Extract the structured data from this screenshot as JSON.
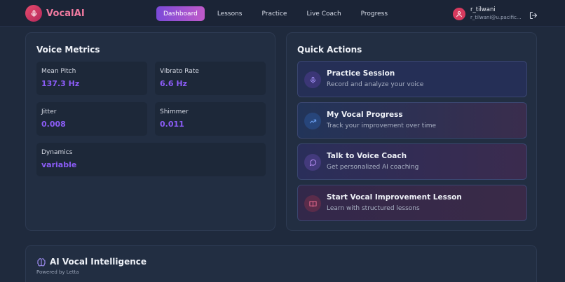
{
  "brand": {
    "name": "VocalAI",
    "accent": "#e64a6c"
  },
  "nav": {
    "items": [
      {
        "label": "Dashboard",
        "active": true
      },
      {
        "label": "Lessons",
        "active": false
      },
      {
        "label": "Practice",
        "active": false
      },
      {
        "label": "Live Coach",
        "active": false
      },
      {
        "label": "Progress",
        "active": false
      }
    ]
  },
  "user": {
    "name": "r_tilwani",
    "email": "r_tilwani@u.pacific..."
  },
  "metrics": {
    "title": "Voice Metrics",
    "items": [
      {
        "label": "Mean Pitch",
        "value": "137.3 Hz"
      },
      {
        "label": "Vibrato Rate",
        "value": "6.6 Hz"
      },
      {
        "label": "Jitter",
        "value": "0.008"
      },
      {
        "label": "Shimmer",
        "value": "0.011"
      },
      {
        "label": "Dynamics",
        "value": "variable"
      }
    ],
    "value_color": "#8b5cf6"
  },
  "actions": {
    "title": "Quick Actions",
    "items": [
      {
        "title": "Practice Session",
        "subtitle": "Record and analyze your voice",
        "icon": "microphone-icon"
      },
      {
        "title": "My Vocal Progress",
        "subtitle": "Track your improvement over time",
        "icon": "trending-up-icon"
      },
      {
        "title": "Talk to Voice Coach",
        "subtitle": "Get personalized AI coaching",
        "icon": "chat-bubble-icon"
      },
      {
        "title": "Start Vocal Improvement Lesson",
        "subtitle": "Learn with structured lessons",
        "icon": "book-icon"
      }
    ]
  },
  "intelligence": {
    "title": "AI Vocal Intelligence",
    "subtitle": "Powered by Letta",
    "icon": "brain-icon"
  }
}
